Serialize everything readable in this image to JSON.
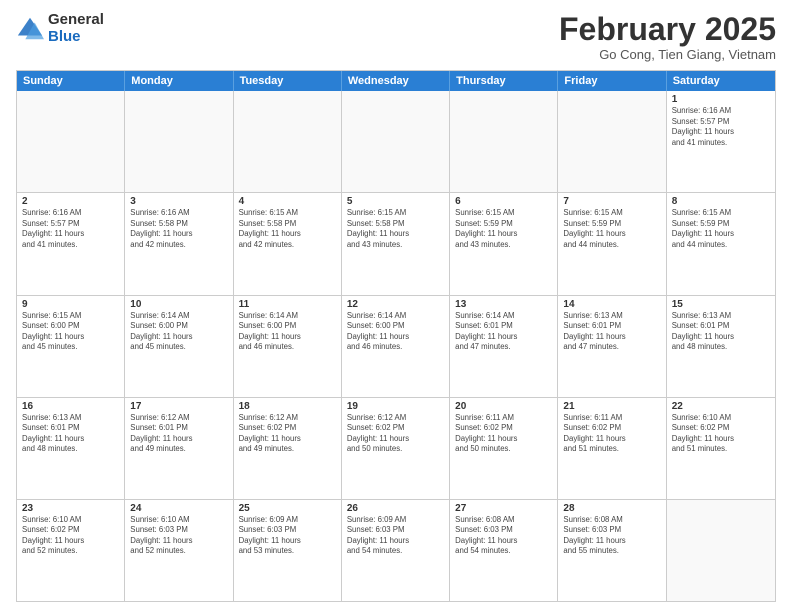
{
  "logo": {
    "general": "General",
    "blue": "Blue"
  },
  "title": "February 2025",
  "subtitle": "Go Cong, Tien Giang, Vietnam",
  "days": [
    "Sunday",
    "Monday",
    "Tuesday",
    "Wednesday",
    "Thursday",
    "Friday",
    "Saturday"
  ],
  "weeks": [
    [
      {
        "day": "",
        "info": ""
      },
      {
        "day": "",
        "info": ""
      },
      {
        "day": "",
        "info": ""
      },
      {
        "day": "",
        "info": ""
      },
      {
        "day": "",
        "info": ""
      },
      {
        "day": "",
        "info": ""
      },
      {
        "day": "1",
        "info": "Sunrise: 6:16 AM\nSunset: 5:57 PM\nDaylight: 11 hours\nand 41 minutes."
      }
    ],
    [
      {
        "day": "2",
        "info": "Sunrise: 6:16 AM\nSunset: 5:57 PM\nDaylight: 11 hours\nand 41 minutes."
      },
      {
        "day": "3",
        "info": "Sunrise: 6:16 AM\nSunset: 5:58 PM\nDaylight: 11 hours\nand 42 minutes."
      },
      {
        "day": "4",
        "info": "Sunrise: 6:15 AM\nSunset: 5:58 PM\nDaylight: 11 hours\nand 42 minutes."
      },
      {
        "day": "5",
        "info": "Sunrise: 6:15 AM\nSunset: 5:58 PM\nDaylight: 11 hours\nand 43 minutes."
      },
      {
        "day": "6",
        "info": "Sunrise: 6:15 AM\nSunset: 5:59 PM\nDaylight: 11 hours\nand 43 minutes."
      },
      {
        "day": "7",
        "info": "Sunrise: 6:15 AM\nSunset: 5:59 PM\nDaylight: 11 hours\nand 44 minutes."
      },
      {
        "day": "8",
        "info": "Sunrise: 6:15 AM\nSunset: 5:59 PM\nDaylight: 11 hours\nand 44 minutes."
      }
    ],
    [
      {
        "day": "9",
        "info": "Sunrise: 6:15 AM\nSunset: 6:00 PM\nDaylight: 11 hours\nand 45 minutes."
      },
      {
        "day": "10",
        "info": "Sunrise: 6:14 AM\nSunset: 6:00 PM\nDaylight: 11 hours\nand 45 minutes."
      },
      {
        "day": "11",
        "info": "Sunrise: 6:14 AM\nSunset: 6:00 PM\nDaylight: 11 hours\nand 46 minutes."
      },
      {
        "day": "12",
        "info": "Sunrise: 6:14 AM\nSunset: 6:00 PM\nDaylight: 11 hours\nand 46 minutes."
      },
      {
        "day": "13",
        "info": "Sunrise: 6:14 AM\nSunset: 6:01 PM\nDaylight: 11 hours\nand 47 minutes."
      },
      {
        "day": "14",
        "info": "Sunrise: 6:13 AM\nSunset: 6:01 PM\nDaylight: 11 hours\nand 47 minutes."
      },
      {
        "day": "15",
        "info": "Sunrise: 6:13 AM\nSunset: 6:01 PM\nDaylight: 11 hours\nand 48 minutes."
      }
    ],
    [
      {
        "day": "16",
        "info": "Sunrise: 6:13 AM\nSunset: 6:01 PM\nDaylight: 11 hours\nand 48 minutes."
      },
      {
        "day": "17",
        "info": "Sunrise: 6:12 AM\nSunset: 6:01 PM\nDaylight: 11 hours\nand 49 minutes."
      },
      {
        "day": "18",
        "info": "Sunrise: 6:12 AM\nSunset: 6:02 PM\nDaylight: 11 hours\nand 49 minutes."
      },
      {
        "day": "19",
        "info": "Sunrise: 6:12 AM\nSunset: 6:02 PM\nDaylight: 11 hours\nand 50 minutes."
      },
      {
        "day": "20",
        "info": "Sunrise: 6:11 AM\nSunset: 6:02 PM\nDaylight: 11 hours\nand 50 minutes."
      },
      {
        "day": "21",
        "info": "Sunrise: 6:11 AM\nSunset: 6:02 PM\nDaylight: 11 hours\nand 51 minutes."
      },
      {
        "day": "22",
        "info": "Sunrise: 6:10 AM\nSunset: 6:02 PM\nDaylight: 11 hours\nand 51 minutes."
      }
    ],
    [
      {
        "day": "23",
        "info": "Sunrise: 6:10 AM\nSunset: 6:02 PM\nDaylight: 11 hours\nand 52 minutes."
      },
      {
        "day": "24",
        "info": "Sunrise: 6:10 AM\nSunset: 6:03 PM\nDaylight: 11 hours\nand 52 minutes."
      },
      {
        "day": "25",
        "info": "Sunrise: 6:09 AM\nSunset: 6:03 PM\nDaylight: 11 hours\nand 53 minutes."
      },
      {
        "day": "26",
        "info": "Sunrise: 6:09 AM\nSunset: 6:03 PM\nDaylight: 11 hours\nand 54 minutes."
      },
      {
        "day": "27",
        "info": "Sunrise: 6:08 AM\nSunset: 6:03 PM\nDaylight: 11 hours\nand 54 minutes."
      },
      {
        "day": "28",
        "info": "Sunrise: 6:08 AM\nSunset: 6:03 PM\nDaylight: 11 hours\nand 55 minutes."
      },
      {
        "day": "",
        "info": ""
      }
    ]
  ]
}
